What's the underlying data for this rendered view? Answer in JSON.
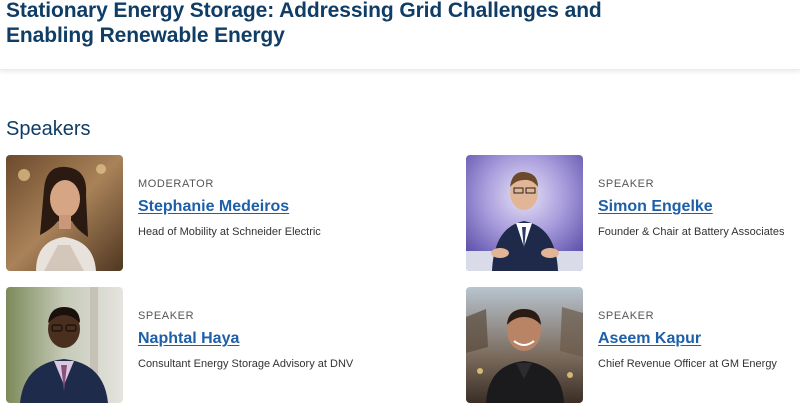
{
  "page": {
    "title": "Stationary Energy Storage: Addressing Grid Challenges and Enabling Renewable Energy"
  },
  "speakers_section": {
    "heading": "Speakers",
    "items": [
      {
        "role": "MODERATOR",
        "name": "Stephanie Medeiros",
        "description": "Head of Mobility at Schneider Electric",
        "photo_icon": "portrait-photo"
      },
      {
        "role": "SPEAKER",
        "name": "Simon Engelke",
        "description": "Founder & Chair at Battery Associates",
        "photo_icon": "portrait-photo"
      },
      {
        "role": "SPEAKER",
        "name": "Naphtal Haya",
        "description": "Consultant Energy Storage Advisory at DNV",
        "photo_icon": "portrait-photo"
      },
      {
        "role": "SPEAKER",
        "name": "Aseem Kapur",
        "description": "Chief Revenue Officer at GM Energy",
        "photo_icon": "portrait-photo"
      }
    ]
  },
  "colors": {
    "title": "#0f3d66",
    "link": "#1e5fa8",
    "role_text": "#555555"
  }
}
